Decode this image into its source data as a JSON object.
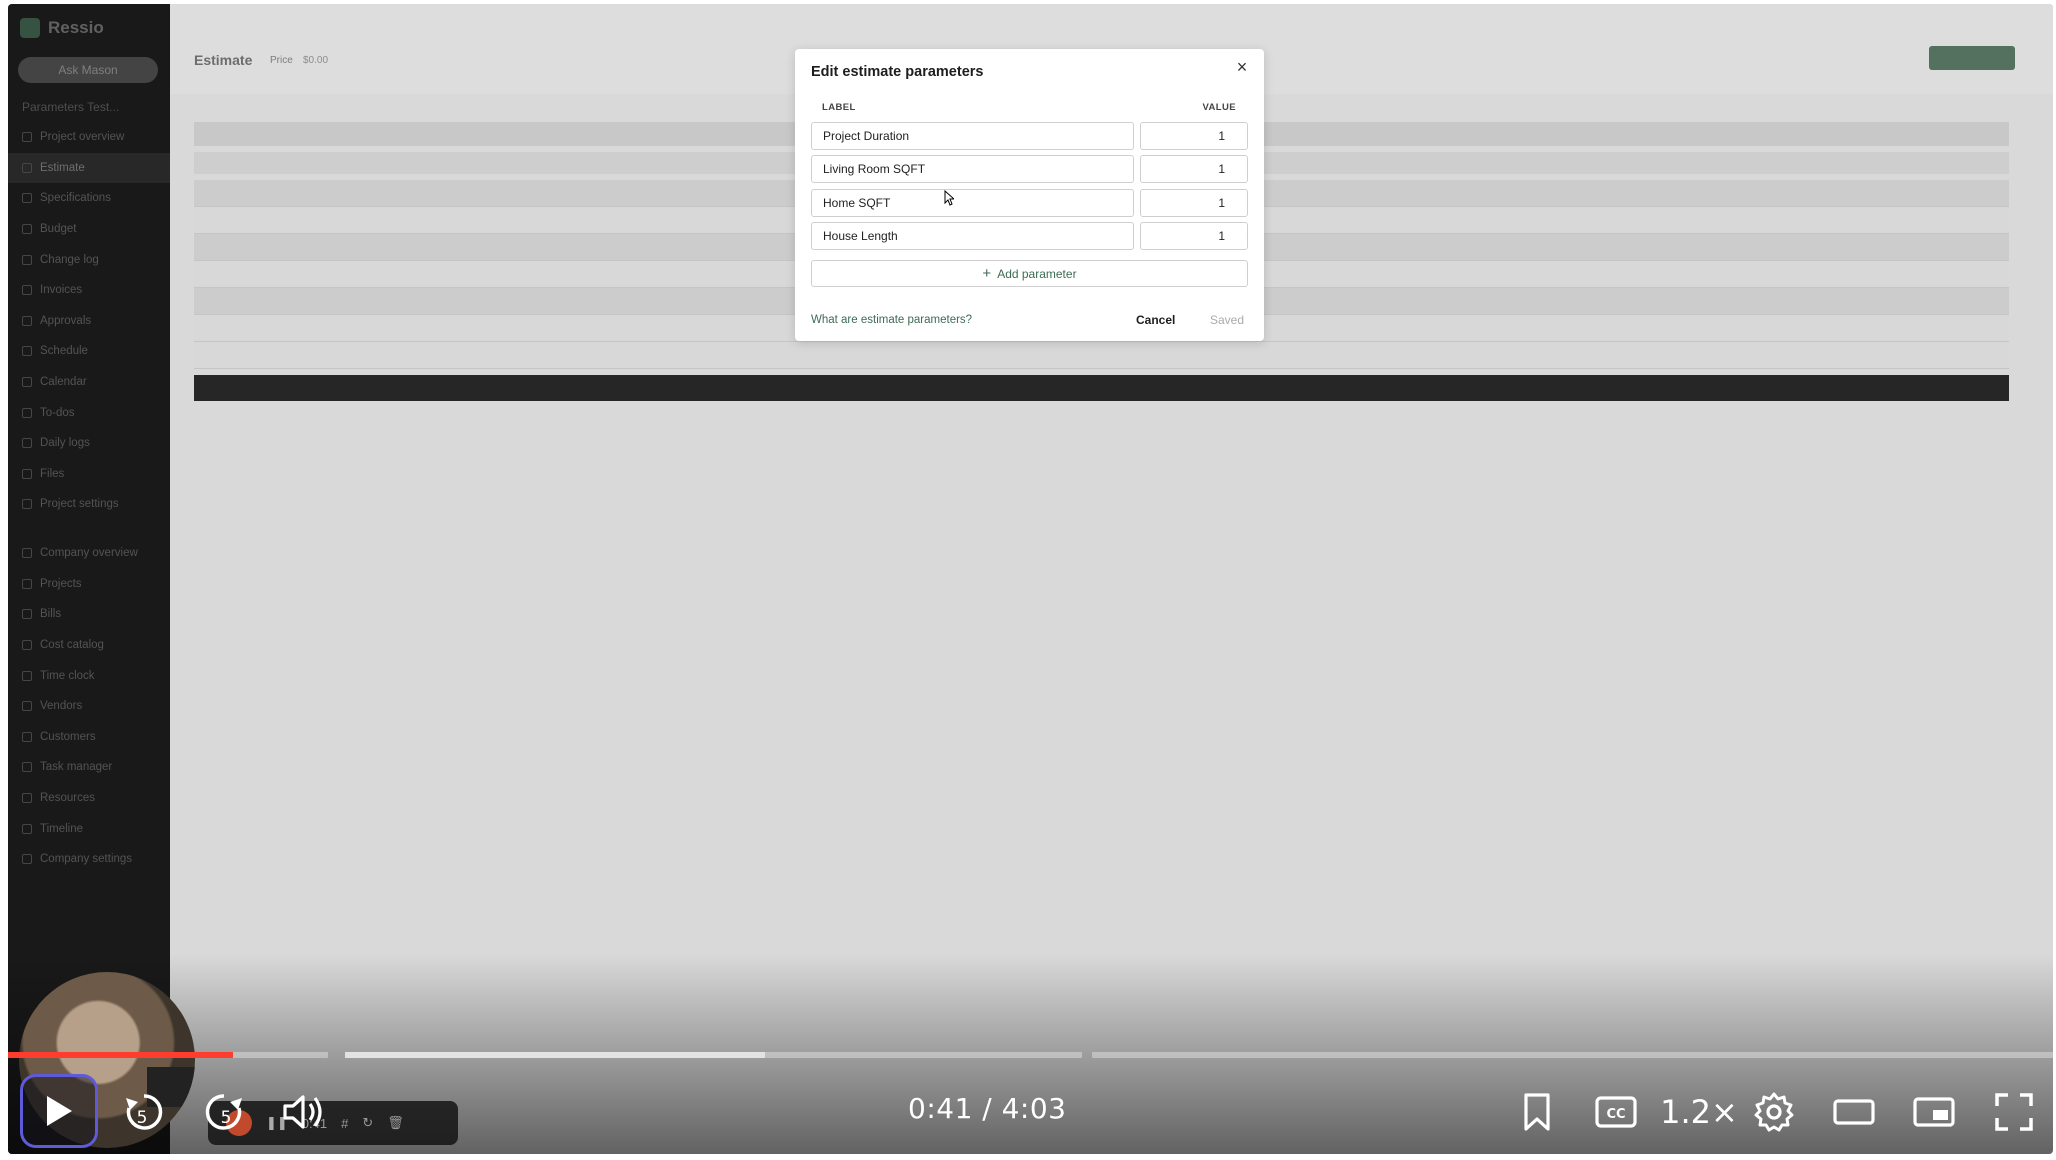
{
  "app": {
    "brand": "Ressio",
    "ask_button": "Ask Mason",
    "project_name": "Parameters Test...",
    "sidebar_items": [
      "Project overview",
      "Estimate",
      "Specifications",
      "Budget",
      "Change log",
      "Invoices",
      "Approvals",
      "Schedule",
      "Calendar",
      "To-dos",
      "Daily logs",
      "Files",
      "Project settings"
    ],
    "sidebar_items_company": [
      "Company overview",
      "Projects",
      "Bills",
      "Cost catalog",
      "Time clock",
      "Vendors",
      "Customers",
      "Task manager",
      "Resources",
      "Timeline",
      "Company settings"
    ],
    "page_title": "Estimate",
    "price_label": "Price",
    "price_value": "$0.00"
  },
  "modal": {
    "title": "Edit estimate parameters",
    "col_label": "LABEL",
    "col_value": "VALUE",
    "parameters": [
      {
        "label": "Project Duration",
        "value": "1"
      },
      {
        "label": "Living Room SQFT",
        "value": "1"
      },
      {
        "label": "Home SQFT",
        "value": "1"
      },
      {
        "label": "House Length",
        "value": "1"
      }
    ],
    "add_button": "Add parameter",
    "help_link": "What are estimate parameters?",
    "cancel": "Cancel",
    "saved": "Saved"
  },
  "player": {
    "time_display": "0:41 / 4:03",
    "speed": "1.2×",
    "skip_back_seconds": "5",
    "skip_forward_seconds": "5",
    "mini_toolbar_time": "0:41",
    "progress": {
      "played_fraction": 0.11,
      "buffered_fraction": 0.37
    },
    "colors": {
      "played": "#ff3d2e",
      "accent": "#5e5ad9"
    }
  }
}
